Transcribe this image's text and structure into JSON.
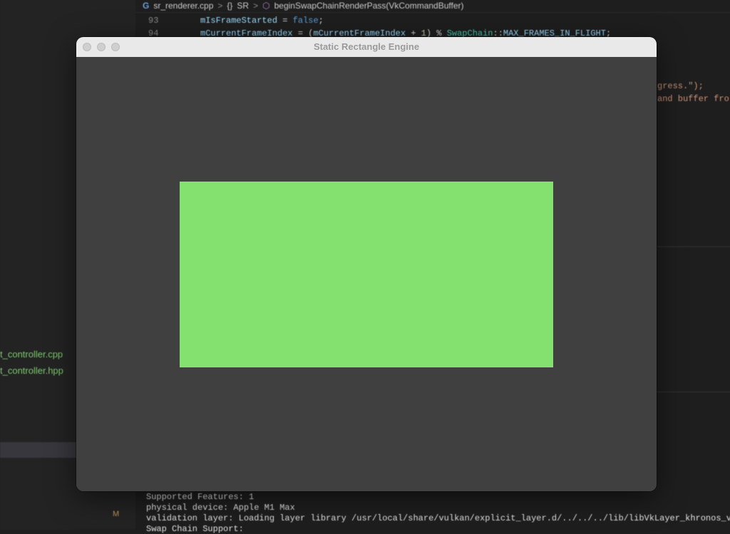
{
  "editor": {
    "breadcrumb": {
      "file": "sr_renderer.cpp",
      "sep1": ">",
      "namespace_icon": "{}",
      "namespace": "SR",
      "sep2": ">",
      "method": "beginSwapChainRenderPass(VkCommandBuffer)"
    },
    "line_numbers": [
      "93",
      "94"
    ],
    "code": {
      "l93_var": "mIsFrameStarted",
      "l93_op": " = ",
      "l93_kw": "false",
      "l93_end": ";",
      "l94_var": "mCurrentFrameIndex",
      "l94_op": " = (",
      "l94_var2": "mCurrentFrameIndex",
      "l94_op2": " + ",
      "l94_num": "1",
      "l94_op3": ") % ",
      "l94_cls": "SwapChain",
      "l94_op4": "::",
      "l94_const": "MAX_FRAMES_IN_FLIGHT",
      "l94_end": ";",
      "frag1": "gress.\");",
      "frag2": "and buffer fro"
    },
    "sidebar_files": [
      "t_controller.cpp",
      "t_controller.hpp"
    ],
    "sidebar_badge": "M",
    "terminal": [
      "        Supported Features: 1",
      "physical device: Apple M1 Max",
      "validation layer: Loading layer library /usr/local/share/vulkan/explicit_layer.d/../../../lib/libVkLayer_khronos_va",
      "        Swap Chain Support:"
    ]
  },
  "window": {
    "title": "Static Rectangle Engine",
    "background_color": "#404040",
    "rect_color": "#84e06f"
  }
}
